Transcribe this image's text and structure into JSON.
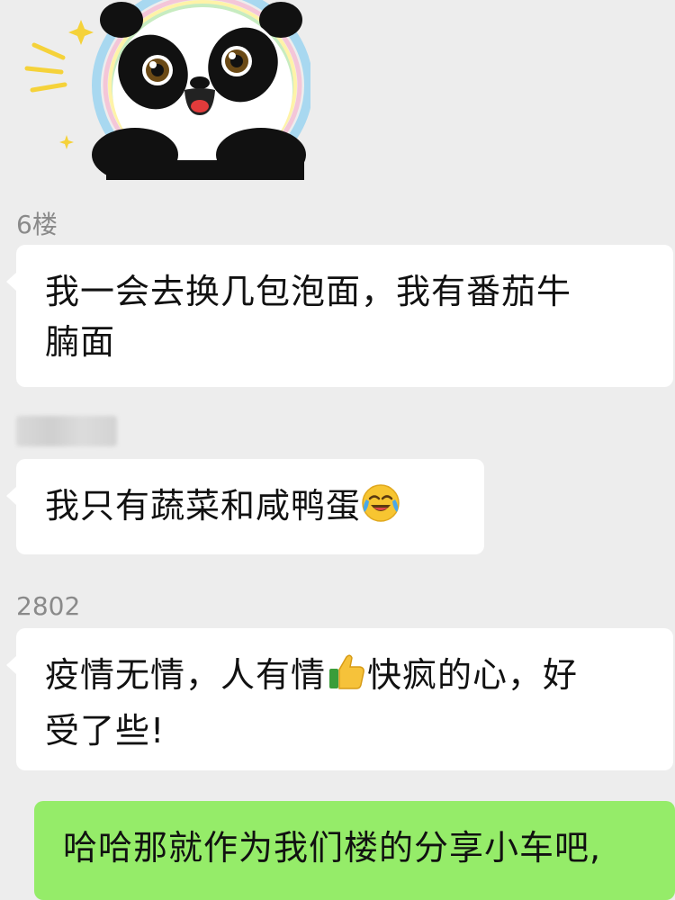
{
  "chat": {
    "messages": [
      {
        "sender": "6楼",
        "text": "我一会去换几包泡面，我有番茄牛腩面",
        "line1": "我一会去换几包泡面，我有番茄牛",
        "line2": "腩面"
      },
      {
        "sender": "",
        "sender_blurred": true,
        "text": "我只有蔬菜和咸鸭蛋",
        "emoji": "face-with-tears-of-joy-icon"
      },
      {
        "sender": "2802",
        "line1_a": "疫情无情，人有情",
        "emoji": "thumbs-up-icon",
        "line1_b": "快疯的心，好",
        "line2": "受了些!"
      },
      {
        "sender": "self",
        "text": "哈哈那就作为我们楼的分享小车吧,"
      }
    ],
    "sticker": "panda-sticker"
  },
  "colors": {
    "background": "#ededed",
    "bubble_other": "#ffffff",
    "bubble_self": "#95ec69",
    "sender_text": "#8a8a8a"
  }
}
